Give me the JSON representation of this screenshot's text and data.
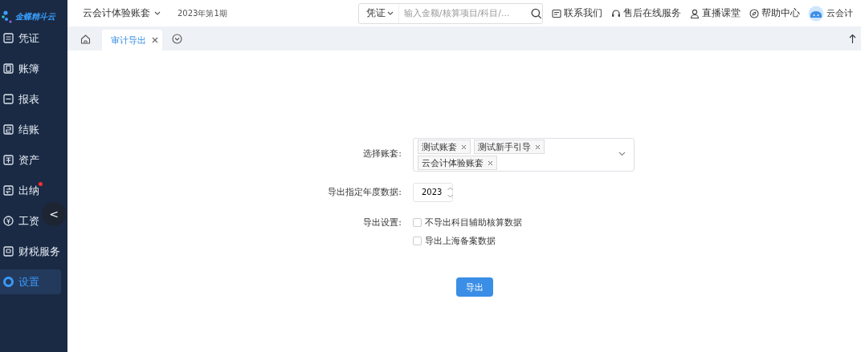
{
  "sidebar": {
    "logo_text": "金蝶精斗云",
    "items": [
      {
        "label": "凭证",
        "selected": false,
        "badge": false
      },
      {
        "label": "账簿",
        "selected": false,
        "badge": false
      },
      {
        "label": "报表",
        "selected": false,
        "badge": false
      },
      {
        "label": "结账",
        "selected": false,
        "badge": false
      },
      {
        "label": "资产",
        "selected": false,
        "badge": false
      },
      {
        "label": "出纳",
        "selected": false,
        "badge": true
      },
      {
        "label": "工资",
        "selected": false,
        "badge": false
      },
      {
        "label": "财税服务",
        "selected": false,
        "badge": false
      },
      {
        "label": "设置",
        "selected": true,
        "badge": false
      }
    ],
    "collapse_button": "<"
  },
  "header": {
    "account_set": "云会计体验账套",
    "period": "2023年第1期",
    "search": {
      "type": "凭证",
      "placeholder": "输入金额/核算项目/科目/..."
    },
    "links": [
      "联系我们",
      "售后在线服务",
      "直播课堂",
      "帮助中心"
    ],
    "user": "云会计"
  },
  "tabs": [
    {
      "label": "审计导出",
      "selected": true,
      "closable": true
    }
  ],
  "form": {
    "fields": [
      {
        "kind": "multiselect",
        "label": "选择账套:",
        "tags": [
          "测试账套",
          "测试新手引导",
          "云会计体验账套"
        ]
      },
      {
        "kind": "number",
        "label": "导出指定年度数据:",
        "value": "2023"
      },
      {
        "kind": "checkboxes",
        "label": "导出设置:",
        "options": [
          {
            "label": "不导出科目辅助核算数据",
            "checked": false
          },
          {
            "label": "导出上海备案数据",
            "checked": false
          }
        ]
      }
    ],
    "submit": "导出"
  }
}
